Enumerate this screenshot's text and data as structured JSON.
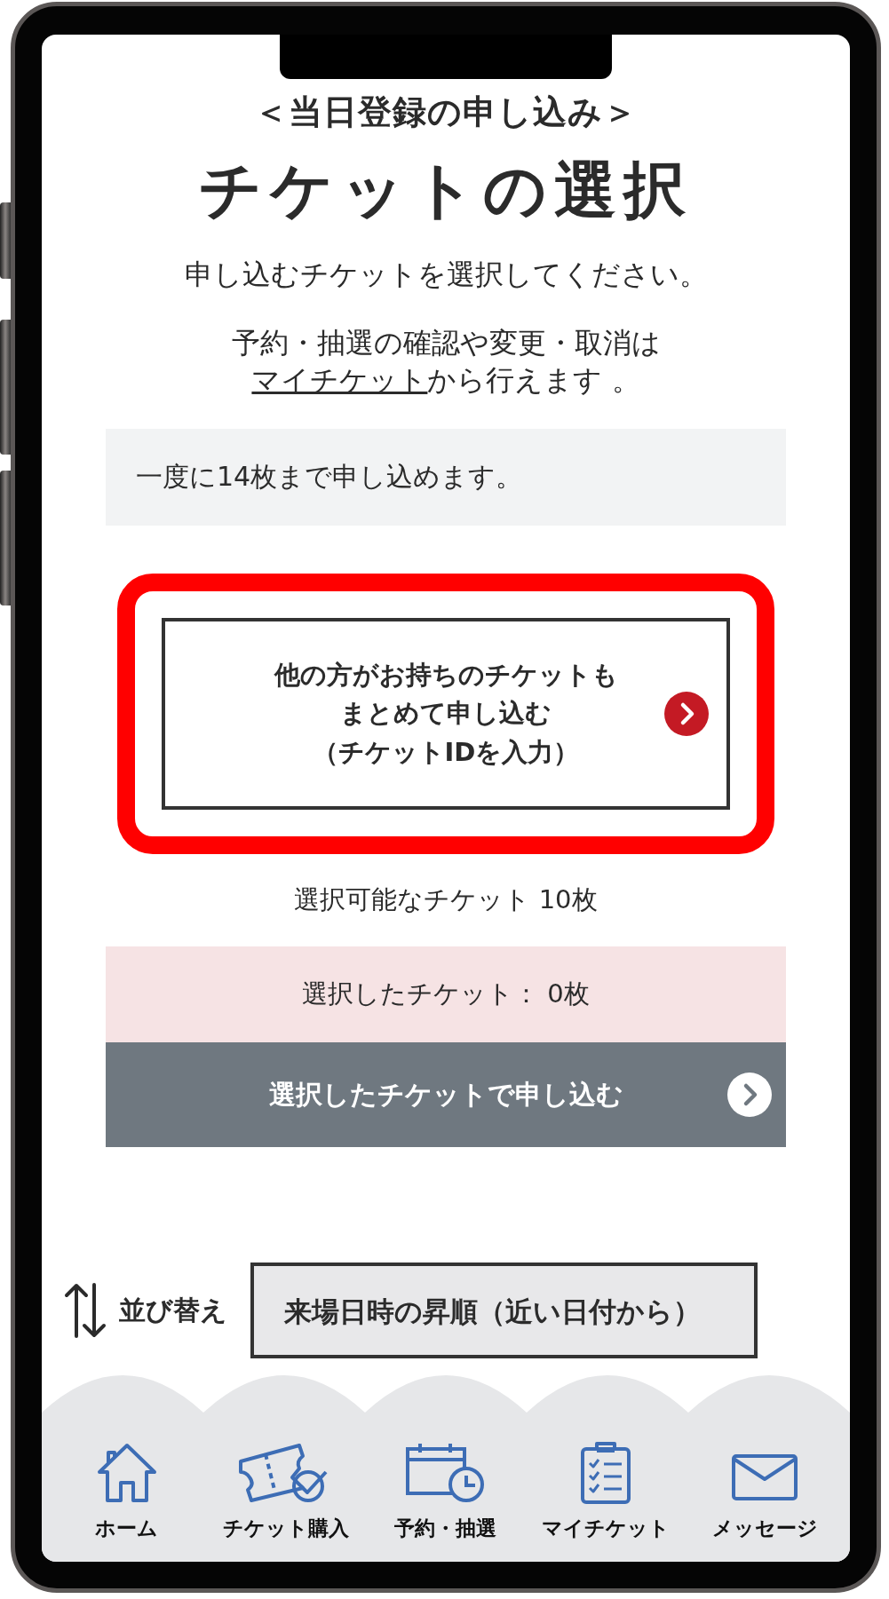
{
  "header": {
    "subtitle": "＜当日登録の申し込み＞",
    "title": "チケットの選択"
  },
  "instruction": "申し込むチケットを選択してください。",
  "note": {
    "text_before": "予約・抽選の確認や変更・取消は",
    "link": "マイチケット",
    "text_after": "から行えます 。"
  },
  "limit_notice": "一度に14枚まで申し込めます。",
  "bulk_button": {
    "lines": [
      "他の方がお持ちのチケットも",
      "まとめて申し込む",
      "（チケットIDを入力）"
    ],
    "highlighted": true
  },
  "available_count": "選択可能なチケット 10枚",
  "selected_count": "選択したチケット： 0枚",
  "apply_button": {
    "label": "選択したチケットで申し込む",
    "disabled": true
  },
  "sort": {
    "label": "並び替え",
    "value": "来場日時の昇順（近い日付から）"
  },
  "nav": [
    {
      "label": "ホーム",
      "kind": "home"
    },
    {
      "label": "チケット購入",
      "kind": "ticket"
    },
    {
      "label": "予約・抽選",
      "kind": "calendar"
    },
    {
      "label": "マイチケット",
      "kind": "clipboard"
    },
    {
      "label": "メッセージ",
      "kind": "mail"
    }
  ]
}
